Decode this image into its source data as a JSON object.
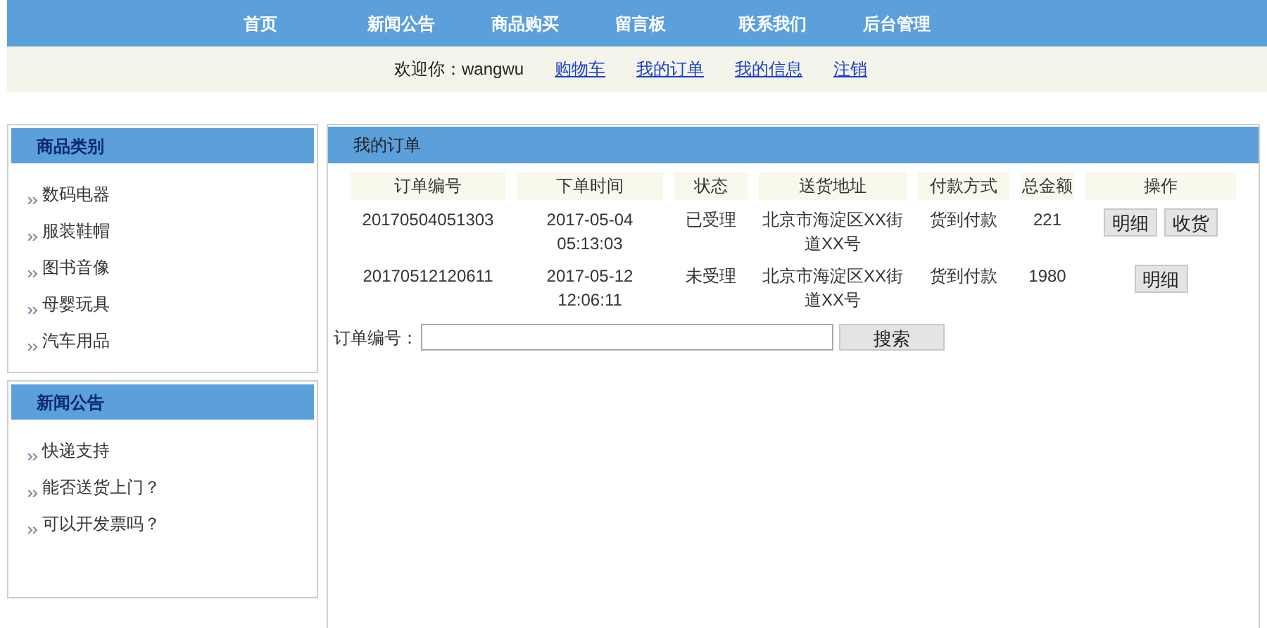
{
  "nav": [
    "首页",
    "新闻公告",
    "商品购买",
    "留言板",
    "联系我们",
    "后台管理"
  ],
  "user_bar": {
    "welcome": "欢迎你：wangwu",
    "links": [
      "购物车",
      "我的订单",
      "我的信息",
      "注销"
    ]
  },
  "sidebar": [
    {
      "title": "商品类别",
      "items": [
        "数码电器",
        "服装鞋帽",
        "图书音像",
        "母婴玩具",
        "汽车用品"
      ]
    },
    {
      "title": "新闻公告",
      "items": [
        "快递支持",
        "能否送货上门？",
        "可以开发票吗？"
      ]
    }
  ],
  "main": {
    "title": "我的订单",
    "table": {
      "columns": [
        "订单编号",
        "下单时间",
        "状态",
        "送货地址",
        "付款方式",
        "总金额",
        "操作"
      ],
      "rows": [
        {
          "order_no": "20170504051303",
          "time": "2017-05-04 05:13:03",
          "status": "已受理",
          "address": "北京市海淀区XX街道XX号",
          "payment": "货到付款",
          "total": "221",
          "actions": [
            "明细",
            "收货"
          ]
        },
        {
          "order_no": "20170512120611",
          "time": "2017-05-12 12:06:11",
          "status": "未受理",
          "address": "北京市海淀区XX街道XX号",
          "payment": "货到付款",
          "total": "1980",
          "actions": [
            "明细"
          ]
        }
      ]
    },
    "search": {
      "label": "订单编号：",
      "button": "搜索"
    }
  }
}
